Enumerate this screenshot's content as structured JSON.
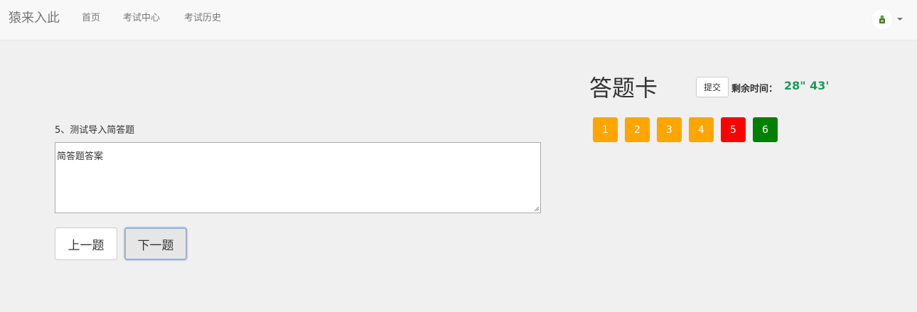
{
  "navbar": {
    "brand": "猿来入此",
    "links": [
      "首页",
      "考试中心",
      "考试历史"
    ]
  },
  "question": {
    "label": "5、测试导入简答题",
    "answer": "简答题答案"
  },
  "buttons": {
    "prev": "上一题",
    "next": "下一题"
  },
  "answer_card": {
    "title": "答题卡",
    "submit": "提交",
    "time_label": "剩余时间：",
    "time_value": "28\" 43'",
    "items": [
      {
        "label": "1",
        "color": "#ffa500"
      },
      {
        "label": "2",
        "color": "#ffa500"
      },
      {
        "label": "3",
        "color": "#ffa500"
      },
      {
        "label": "4",
        "color": "#ffa500"
      },
      {
        "label": "5",
        "color": "#ff0000"
      },
      {
        "label": "6",
        "color": "#008000"
      }
    ]
  },
  "colors": {
    "answered": "#ffa500",
    "current": "#ff0000",
    "unanswered": "#008000",
    "timer": "#1a9a5a"
  }
}
